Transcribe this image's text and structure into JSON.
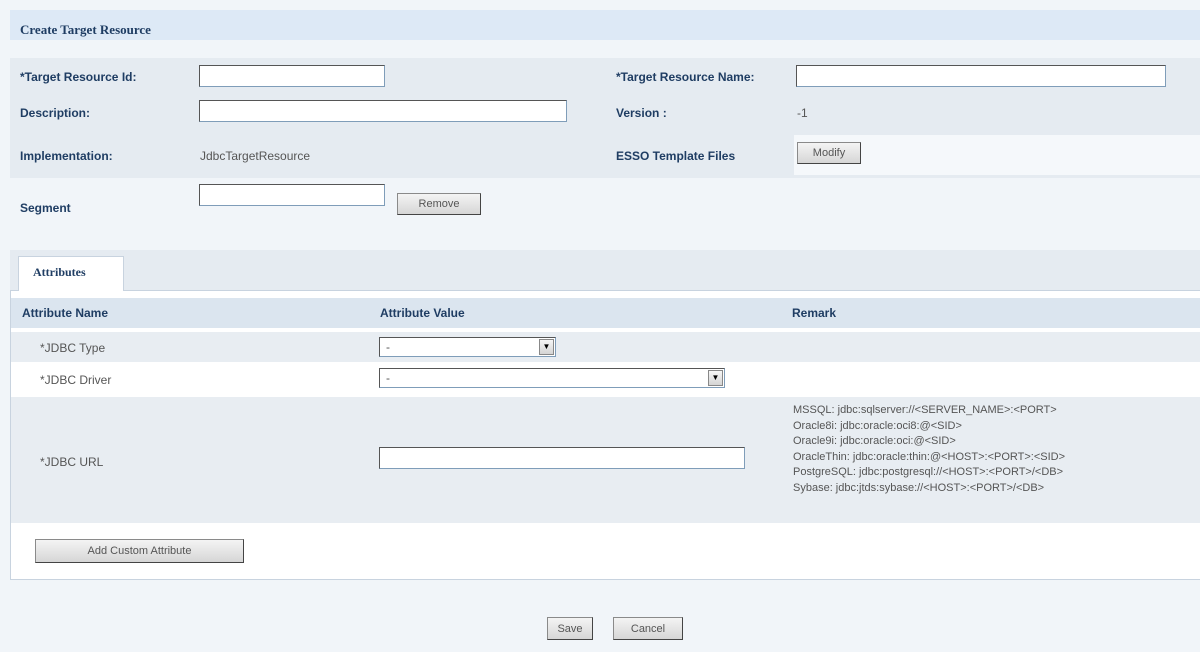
{
  "header": {
    "title": "Create Target Resource"
  },
  "form": {
    "target_resource_id_label": "*Target Resource Id:",
    "target_resource_id_value": "",
    "target_resource_name_label": "*Target Resource Name:",
    "target_resource_name_value": "",
    "description_label": "Description:",
    "description_value": "",
    "version_label": "Version :",
    "version_value": "-1",
    "implementation_label": "Implementation:",
    "implementation_value": "JdbcTargetResource",
    "esso_label": "ESSO Template Files",
    "modify_button": "Modify",
    "segment_label": "Segment",
    "segment_value": "",
    "remove_button": "Remove"
  },
  "tabs": [
    {
      "label": "Attributes",
      "active": true
    }
  ],
  "attributes": {
    "columns": [
      "Attribute Name",
      "Attribute Value",
      "Remark"
    ],
    "rows": [
      {
        "name": "*JDBC Type",
        "value": "-"
      },
      {
        "name": "*JDBC Driver",
        "value": "-"
      },
      {
        "name": "*JDBC URL",
        "value": "",
        "remark": [
          "MSSQL: jdbc:sqlserver://<SERVER_NAME>:<PORT>",
          "Oracle8i: jdbc:oracle:oci8:@<SID>",
          "Oracle9i: jdbc:oracle:oci:@<SID>",
          "OracleThin: jdbc:oracle:thin:@<HOST>:<PORT>:<SID>",
          "PostgreSQL: jdbc:postgresql://<HOST>:<PORT>/<DB>",
          "Sybase: jdbc:jtds:sybase://<HOST>:<PORT>/<DB>"
        ]
      }
    ],
    "add_custom_button": "Add Custom Attribute"
  },
  "footer": {
    "save_button": "Save",
    "cancel_button": "Cancel"
  },
  "colors": {
    "header_bg": "#dde9f6",
    "label_text": "#1f3d63",
    "band_bg": "#e5ebf1"
  }
}
